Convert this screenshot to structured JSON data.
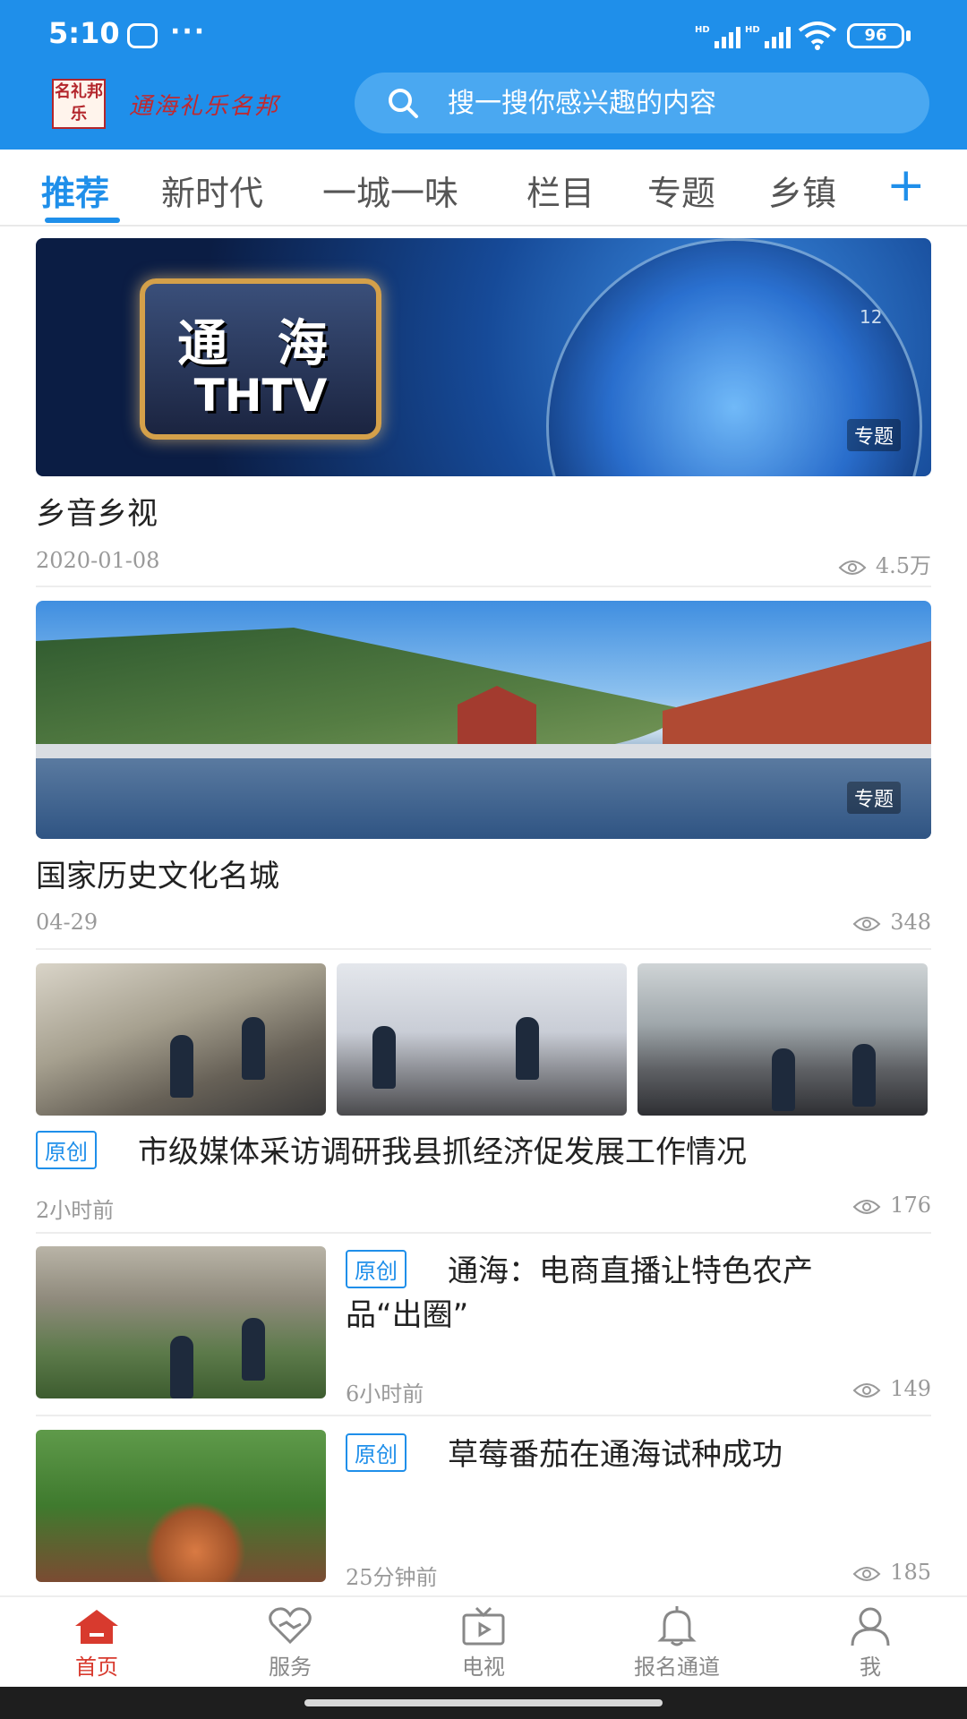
{
  "status_bar": {
    "time": "5:10",
    "dots": "···",
    "battery": "96",
    "icons": [
      "message-icon",
      "hd-signal-icon",
      "hd-signal-icon",
      "wifi-icon",
      "battery-icon"
    ]
  },
  "header": {
    "logo_text": "通海礼乐名邦",
    "logo_seal": "名礼邦乐",
    "search_placeholder": "搜一搜你感兴趣的内容",
    "accent": "#1f8fea"
  },
  "tabs": {
    "items": [
      "推荐",
      "新时代",
      "一城一味",
      "栏目",
      "专题",
      "乡镇"
    ],
    "active": "推荐",
    "add": "+"
  },
  "feed": {
    "banner1": {
      "badge": "专题",
      "image_text_1": "通 海",
      "image_text_2": "THTV",
      "image_num": "12",
      "title": "乡音乡视",
      "date": "2020-01-08",
      "views": "4.5万"
    },
    "banner2": {
      "badge": "专题",
      "title": "国家历史文化名城",
      "date": "04-29",
      "views": "348"
    },
    "article1": {
      "tag": "原创",
      "title": "市级媒体采访调研我县抓经济促发展工作情况",
      "time": "2小时前",
      "views": "176"
    },
    "article2": {
      "tag": "原创",
      "title_line1": "通海：电商直播让特色农产",
      "title_line2": "品“出圈”",
      "time": "6小时前",
      "views": "149"
    },
    "article3": {
      "tag": "原创",
      "title": "草莓番茄在通海试种成功",
      "time": "25分钟前",
      "views": "185"
    }
  },
  "bottom_nav": {
    "items": [
      {
        "label": "首页",
        "icon": "home-icon",
        "active": true
      },
      {
        "label": "服务",
        "icon": "service-icon",
        "active": false
      },
      {
        "label": "电视",
        "icon": "tv-icon",
        "active": false
      },
      {
        "label": "报名通道",
        "icon": "bell-icon",
        "active": false
      },
      {
        "label": "我",
        "icon": "user-icon",
        "active": false
      }
    ],
    "active_color": "#d83a2e"
  }
}
